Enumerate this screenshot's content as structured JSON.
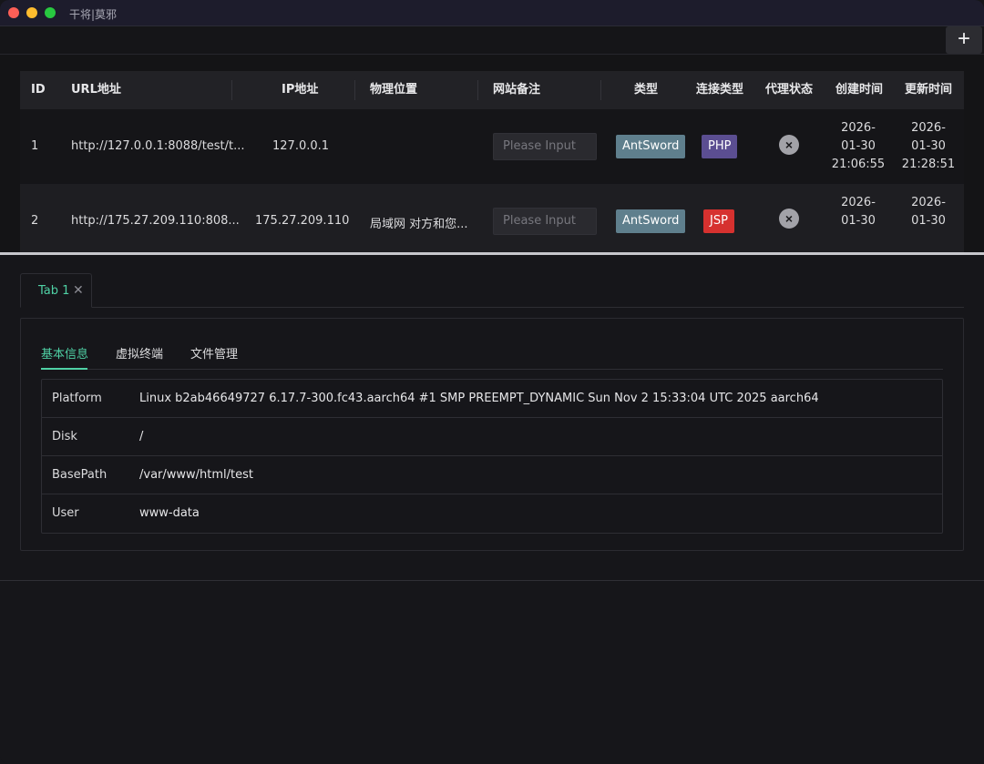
{
  "window": {
    "title": "干将|莫邪"
  },
  "toolbar": {
    "add_label": "+"
  },
  "table": {
    "columns": [
      "ID",
      "URL地址",
      "IP地址",
      "物理位置",
      "网站备注",
      "类型",
      "连接类型",
      "代理状态",
      "创建时间",
      "更新时间"
    ],
    "rows": [
      {
        "id": "1",
        "url": "http://127.0.0.1:8088/test/t...",
        "ip": "127.0.0.1",
        "location": "",
        "note_placeholder": "Please Input",
        "type": "AntSword",
        "conn_type": "PHP",
        "proxy_status": "×",
        "created": [
          "2026-",
          "01-30",
          "21:06:55"
        ],
        "updated": [
          "2026-",
          "01-30",
          "21:28:51"
        ]
      },
      {
        "id": "2",
        "url": "http://175.27.209.110:808...",
        "ip": "175.27.209.110",
        "location": "局域网 对方和您...",
        "note_placeholder": "Please Input",
        "type": "AntSword",
        "conn_type": "JSP",
        "proxy_status": "×",
        "created": [
          "2026-",
          "01-30"
        ],
        "updated": [
          "2026-",
          "01-30"
        ]
      }
    ]
  },
  "panel": {
    "tab_label": "Tab 1",
    "tab_close": "✕",
    "subtabs": [
      "基本信息",
      "虚拟终端",
      "文件管理"
    ],
    "info": [
      {
        "key": "Platform",
        "value": "Linux b2ab46649727 6.17.7-300.fc43.aarch64 #1 SMP PREEMPT_DYNAMIC Sun Nov 2 15:33:04 UTC 2025 aarch64"
      },
      {
        "key": "Disk",
        "value": "/"
      },
      {
        "key": "BasePath",
        "value": "/var/www/html/test"
      },
      {
        "key": "User",
        "value": "www-data"
      }
    ]
  },
  "colors": {
    "accent": "#4fd1a5",
    "tag_antsword": "#5f7f8d",
    "tag_php": "#5b4e91",
    "tag_jsp": "#d6312f"
  }
}
